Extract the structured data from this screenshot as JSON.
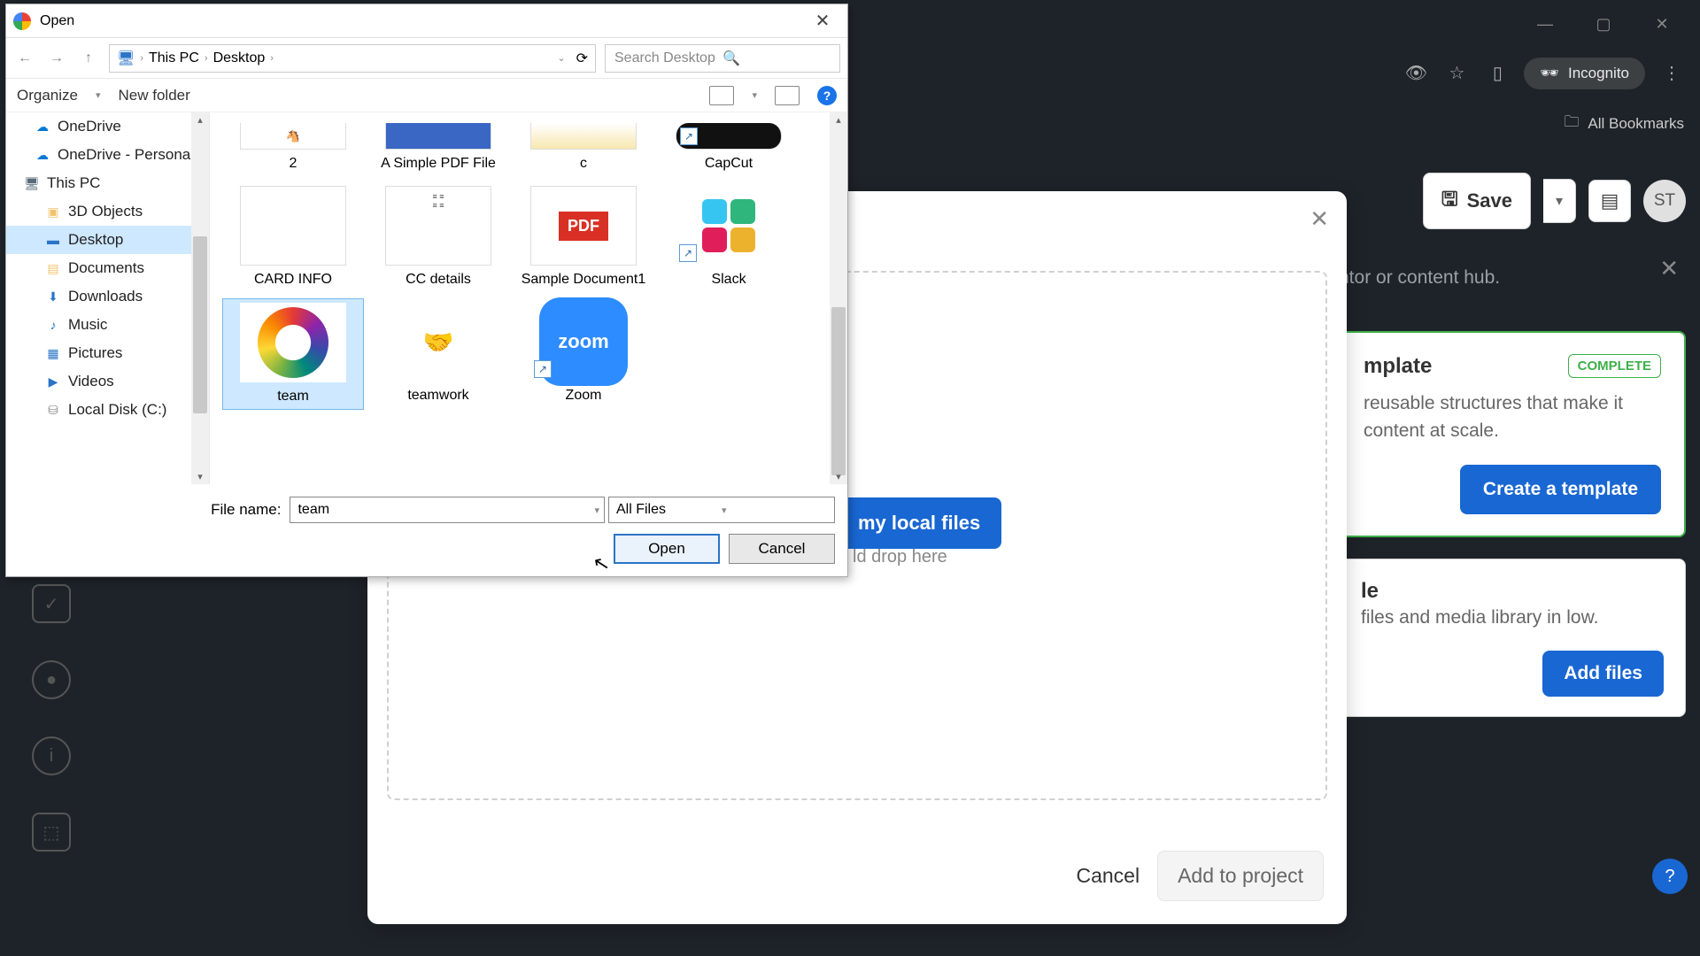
{
  "browser": {
    "incognito_label": "Incognito",
    "all_bookmarks": "All Bookmarks"
  },
  "app": {
    "save_label": "Save",
    "avatar_initials": "ST",
    "template_card": {
      "title": "mplate",
      "badge": "COMPLETE",
      "desc": "reusable structures that make it content at scale.",
      "cta": "Create a template"
    },
    "files_card": {
      "title": "le",
      "desc": "files and media library in low.",
      "cta": "Add files"
    },
    "top_blur": "ntor or content hub."
  },
  "modal": {
    "browse": "my local files",
    "drag_text": "ld drop here",
    "cancel": "Cancel",
    "add": "Add to project"
  },
  "dialog": {
    "title": "Open",
    "path": {
      "root": "This PC",
      "folder": "Desktop"
    },
    "search_placeholder": "Search Desktop",
    "organize": "Organize",
    "new_folder": "New folder",
    "tree": [
      {
        "label": "OneDrive",
        "icon": "cloud"
      },
      {
        "label": "OneDrive - Personal",
        "icon": "cloud"
      },
      {
        "label": "This PC",
        "icon": "pc"
      },
      {
        "label": "3D Objects",
        "icon": "folder",
        "indent": true
      },
      {
        "label": "Desktop",
        "icon": "folder",
        "indent": true,
        "selected": true
      },
      {
        "label": "Documents",
        "icon": "folder",
        "indent": true
      },
      {
        "label": "Downloads",
        "icon": "folder",
        "indent": true
      },
      {
        "label": "Music",
        "icon": "folder",
        "indent": true
      },
      {
        "label": "Pictures",
        "icon": "folder",
        "indent": true
      },
      {
        "label": "Videos",
        "icon": "folder",
        "indent": true
      },
      {
        "label": "Local Disk (C:)",
        "icon": "disk",
        "indent": true
      }
    ],
    "files_row1": [
      "2",
      "A Simple PDF File",
      "c",
      "CapCut"
    ],
    "files_row2": [
      "CARD INFO",
      "CC details",
      "Sample Document1",
      "Slack"
    ],
    "files_row3": [
      "team",
      "teamwork",
      "Zoom"
    ],
    "filename_label": "File name:",
    "filename_value": "team",
    "filetype": "All Files",
    "open": "Open",
    "cancel": "Cancel"
  }
}
